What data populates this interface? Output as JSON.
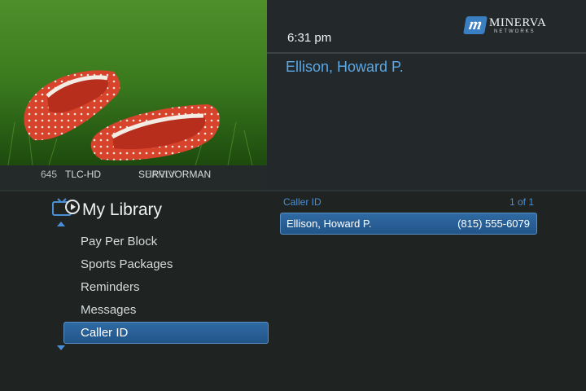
{
  "channel": {
    "number": "645",
    "name": "TLC-HD",
    "program": "SURVIVORMAN",
    "program_overlay": "EARLY"
  },
  "header": {
    "time": "6:31 pm",
    "logo_letter": "m",
    "logo_name": "MINERVA",
    "logo_sub": "NETWORKS",
    "caller_name": "Ellison, Howard P."
  },
  "menu": {
    "title": "My Library",
    "items": [
      "Pay Per Block",
      "Sports Packages",
      "Reminders",
      "Messages",
      "Caller ID"
    ],
    "selected_index": 4
  },
  "caller_list": {
    "heading": "Caller ID",
    "page_info": "1 of 1",
    "rows": [
      {
        "name": "Ellison, Howard P.",
        "phone": "(815) 555-6079"
      }
    ]
  },
  "colors": {
    "background": "#1f2423",
    "accent": "#5aa7e6",
    "selection": "#2a5f96"
  }
}
